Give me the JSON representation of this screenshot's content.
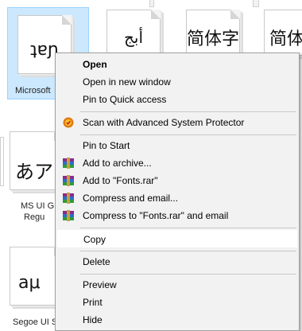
{
  "files": [
    {
      "glyph": "ʇɐɲ",
      "label": "Microsoft",
      "selected": true
    },
    {
      "glyph": "أبج",
      "label": ""
    },
    {
      "glyph": "简体字",
      "label": ""
    },
    {
      "glyph": "简体",
      "label": ""
    },
    {
      "glyph": "あア",
      "label": "MS UI G"
    },
    {
      "glyph": "aμ",
      "label": "Segoe UI S"
    }
  ],
  "file_label_lines": {
    "ms_ui_line2": "Regu"
  },
  "menu": {
    "items": [
      {
        "label": "Open",
        "bold": true
      },
      {
        "label": "Open in new window"
      },
      {
        "label": "Pin to Quick access"
      },
      {
        "label": "Scan with Advanced System Protector",
        "icon": "shield-icon"
      },
      {
        "label": "Pin to Start"
      },
      {
        "label": "Add to archive...",
        "icon": "winrar-icon"
      },
      {
        "label": "Add to \"Fonts.rar\"",
        "icon": "winrar-icon"
      },
      {
        "label": "Compress and email...",
        "icon": "winrar-icon"
      },
      {
        "label": "Compress to \"Fonts.rar\" and email",
        "icon": "winrar-icon"
      },
      {
        "label": "Copy",
        "highlighted": true
      },
      {
        "label": "Delete"
      },
      {
        "label": "Preview"
      },
      {
        "label": "Print"
      },
      {
        "label": "Hide"
      }
    ]
  },
  "colors": {
    "selection": "#cce8ff",
    "menu_bg": "#f2f2f2",
    "hover": "#ffffff"
  }
}
